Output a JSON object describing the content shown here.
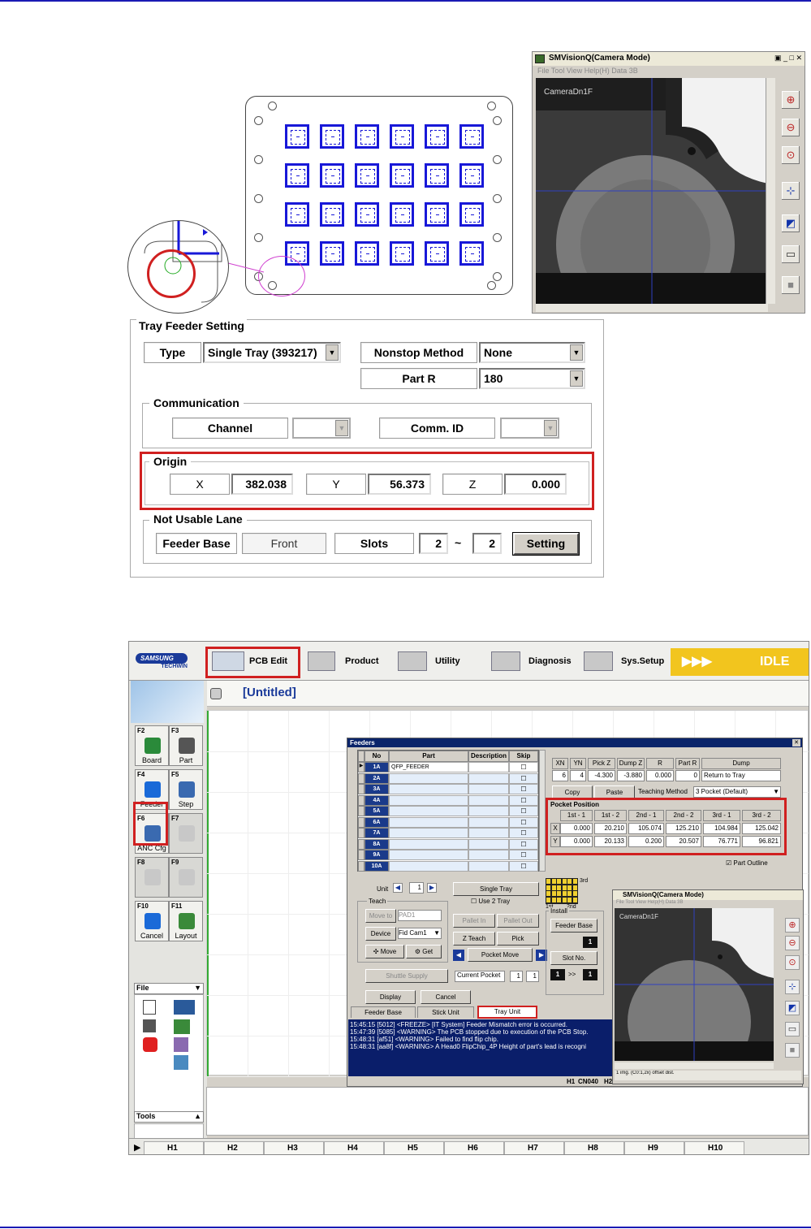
{
  "camera_window": {
    "title": "SMVisionQ(Camera Mode)",
    "menu": "File  Tool  View  Help(H)  Data  3B",
    "view_label": "CameraDn1F"
  },
  "tray_feeder_setting": {
    "title": "Tray Feeder Setting",
    "type_label": "Type",
    "type_value": "Single Tray (393217)",
    "nonstop_label": "Nonstop Method",
    "nonstop_value": "None",
    "partr_label": "Part R",
    "partr_value": "180",
    "communication": {
      "title": "Communication",
      "channel_label": "Channel",
      "commid_label": "Comm. ID"
    },
    "origin": {
      "title": "Origin",
      "x_label": "X",
      "x_value": "382.038",
      "y_label": "Y",
      "y_value": "56.373",
      "z_label": "Z",
      "z_value": "0.000"
    },
    "not_usable": {
      "title": "Not Usable Lane",
      "feeder_base_label": "Feeder Base",
      "feeder_base_value": "Front",
      "slots_label": "Slots",
      "slot_from": "2",
      "tilde": "~",
      "slot_to": "2",
      "setting_button": "Setting"
    }
  },
  "app": {
    "logo_top": "SAMSUNG",
    "logo_bottom": "TECHWIN",
    "tabs": [
      "PCB Edit",
      "Product",
      "Utility",
      "Diagnosis",
      "Sys.Setup"
    ],
    "arrows": "▶▶▶",
    "status": "IDLE",
    "doc_title": "[Untitled]",
    "fkeys": [
      {
        "key": "F2",
        "label": "Board"
      },
      {
        "key": "F3",
        "label": "Part"
      },
      {
        "key": "F4",
        "label": "Feeder"
      },
      {
        "key": "F5",
        "label": "Step"
      },
      {
        "key": "F6",
        "label": "ANC Cfg"
      },
      {
        "key": "F7",
        "label": ""
      },
      {
        "key": "F8",
        "label": ""
      },
      {
        "key": "F9",
        "label": ""
      },
      {
        "key": "F10",
        "label": "Cancel"
      },
      {
        "key": "F11",
        "label": "Layout"
      }
    ],
    "file_menu": "File",
    "tools_menu": "Tools",
    "h_cells": [
      "H1",
      "H2",
      "H3",
      "H4",
      "H5",
      "H6",
      "H7",
      "H8",
      "H9",
      "H10"
    ]
  },
  "feeders": {
    "title": "Feeders",
    "headers": [
      "No",
      "Part",
      "Description",
      "Skip"
    ],
    "rows": [
      {
        "no": "1A",
        "part": "QFP_FEEDER"
      },
      {
        "no": "2A",
        "part": ""
      },
      {
        "no": "3A",
        "part": ""
      },
      {
        "no": "4A",
        "part": ""
      },
      {
        "no": "5A",
        "part": ""
      },
      {
        "no": "6A",
        "part": ""
      },
      {
        "no": "7A",
        "part": ""
      },
      {
        "no": "8A",
        "part": ""
      },
      {
        "no": "9A",
        "part": ""
      },
      {
        "no": "10A",
        "part": ""
      }
    ],
    "xn_headers": [
      "XN",
      "YN",
      "Pick Z",
      "Dump Z",
      "R",
      "Part R",
      "Dump"
    ],
    "xn_values": [
      "6",
      "4",
      "-4.300",
      "-3.880",
      "0.000",
      "0",
      "Return to Tray"
    ],
    "copy": "Copy",
    "paste": "Paste",
    "teaching_method_label": "Teaching Method",
    "teaching_method_value": "3 Pocket (Default)",
    "pocket_title": "Pocket Position",
    "pocket_headers": [
      "1st - 1",
      "1st - 2",
      "2nd - 1",
      "2nd - 2",
      "3rd - 1",
      "3rd - 2"
    ],
    "pocket_x_label": "X",
    "pocket_x": [
      "0.000",
      "20.210",
      "105.074",
      "125.210",
      "104.984",
      "125.042"
    ],
    "pocket_y_label": "Y",
    "pocket_y": [
      "0.000",
      "20.133",
      "0.200",
      "20.507",
      "76.771",
      "96.821"
    ],
    "part_outline": "Part Outline",
    "mini_1st": "1st",
    "mini_2nd": "2nd",
    "mini_3rd": "3rd",
    "unit_label": "Unit",
    "unit_value": "1",
    "single_tray": "Single Tray",
    "use_2_tray": "Use 2 Tray",
    "teach": "Teach",
    "move_to": "Move to",
    "move_to_value": "PAD1",
    "device": "Device",
    "device_value": "Fid Cam1",
    "move": "Move",
    "get": "Get",
    "pallet_in": "Pallet In",
    "pallet_out": "Pallet Out",
    "z_teach": "Z Teach",
    "pick": "Pick",
    "pocket_move": "Pocket Move",
    "shuttle_supply": "Shuttle Supply",
    "current_pocket": "Current Pocket",
    "current_pocket_a": "1",
    "current_pocket_b": "1",
    "install": "Install",
    "feeder_base": "Feeder Base",
    "feeder_base_val": "1",
    "slot_no": "Slot No.",
    "slot_a": "1",
    "slot_arrow": ">>",
    "slot_b": "1",
    "display": "Display",
    "cancel": "Cancel",
    "tabs": [
      "Feeder Base",
      "Stick Unit",
      "Tray Unit"
    ],
    "log": [
      "15:45:15 [5012] <FREEZE> [IT System] Feeder Mismatch error is occurred.",
      "15:47:39 [5085] <WARNING> The PCB stopped due to execution of the PCB Stop.",
      "15:48:31 [af51] <WARNING>  Failed to find flip chip.",
      "15:48:31 [aa8f] <WARNING>  A Head0 FlipChip_4P Height of part's lead is recogni"
    ],
    "bottom_status": [
      "H1",
      "CN040",
      "H2"
    ]
  },
  "camera_window_small": {
    "title": "SMVisionQ(Camera Mode)",
    "menu": "File  Tool  View  Help(H)  Data  3B",
    "view_label": "CameraDn1F",
    "status": "1 img. (C0:1,2x) offset              dist."
  }
}
